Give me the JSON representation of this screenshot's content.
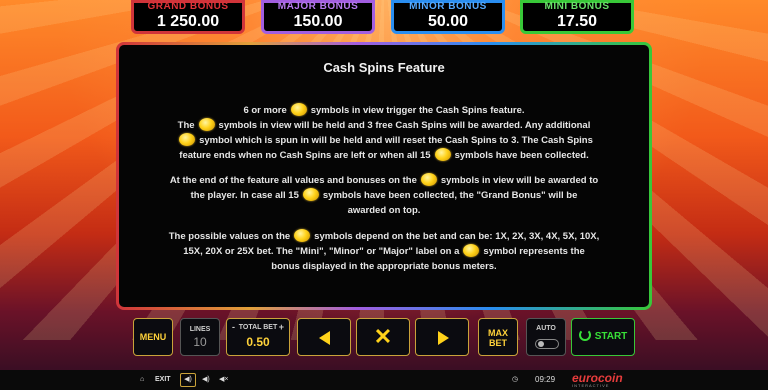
{
  "meters": {
    "grand": {
      "label": "GRAND BONUS",
      "value": "1 250.00",
      "color": "#d0343a"
    },
    "major": {
      "label": "MAJOR BONUS",
      "value": "150.00",
      "color": "#a25ee0"
    },
    "minor": {
      "label": "MINOR BONUS",
      "value": "50.00",
      "color": "#2a8ef0"
    },
    "mini": {
      "label": "MINI BONUS",
      "value": "17.50",
      "color": "#38c838"
    }
  },
  "panel": {
    "title": "Cash Spins Feature",
    "para1": {
      "l1a": "6 or more",
      "l1b": "symbols in view trigger the Cash Spins feature.",
      "l2a": "The",
      "l2b": "symbols in view will be held and 3 free Cash Spins will be awarded. Any additional",
      "l3b": "symbol which is spun in will be held and will reset the Cash Spins to 3. The Cash Spins",
      "l4a": "feature ends when no Cash Spins are left or when all 15",
      "l4b": "symbols have been collected."
    },
    "para2": {
      "l1a": "At the end of the feature all values and bonuses on the",
      "l1b": "symbols in view will be awarded to",
      "l2a": "the player. In case all 15",
      "l2b": "symbols have been collected, the \"Grand Bonus\" will be",
      "l3": "awarded on top."
    },
    "para3": {
      "l1a": "The possible values on the",
      "l1b": "symbols depend on the bet and can be: 1X, 2X, 3X, 4X, 5X, 10X,",
      "l2a": "15X, 20X or 25X bet. The \"Mini\", \"Minor\" or \"Major\" label on a",
      "l2b": "symbol represents the",
      "l3": "bonus displayed in the appropriate bonus meters."
    },
    "symbol_icon": "gold-coin-icon"
  },
  "controls": {
    "menu_label": "MENU",
    "lines_label": "LINES",
    "lines_value": "10",
    "total_bet_label": "TOTAL BET",
    "total_bet_minus": "-",
    "total_bet_plus": "+",
    "total_bet_value": "0.50",
    "close_glyph": "✕",
    "max_bet_line1": "MAX",
    "max_bet_line2": "BET",
    "auto_label": "AUTO",
    "auto_on": false,
    "start_label": "START"
  },
  "statusbar": {
    "home_icon": "⌂",
    "exit_label": "EXIT",
    "sound_icon_active": "◀)",
    "sound_icon_2": "◀)",
    "sound_icon_3": "◀×",
    "clock_icon": "◷",
    "time": "09:29",
    "logo": "eurocoin",
    "logo_sub": "INTERACTIVE"
  }
}
